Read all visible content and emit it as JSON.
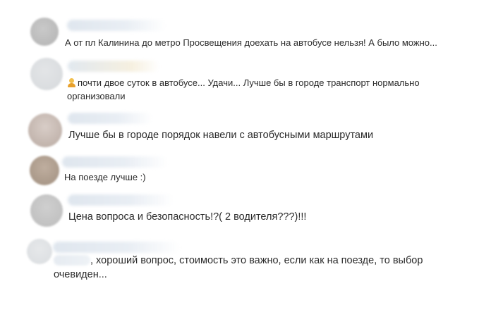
{
  "comments": [
    {
      "text": "А от пл Калинина до метро Просвещения доехать на автобусе нельзя! А было можно..."
    },
    {
      "line1": "почти двое суток в автобусе... Удачи... Лучше бы в городе транспорт нормально",
      "line2": "организовали"
    },
    {
      "text": "Лучше бы в городе порядок навели с автобусными маршрутами"
    },
    {
      "text": "На поезде лучше :)"
    },
    {
      "text": "Цена вопроса и безопасность!?( 2 водителя???)!!!"
    },
    {
      "line1": ", хороший вопрос, стоимость это важно, если как на поезде, то выбор",
      "line2": "очевиден..."
    }
  ],
  "icons": {
    "emoji": "person-emoji-icon"
  }
}
